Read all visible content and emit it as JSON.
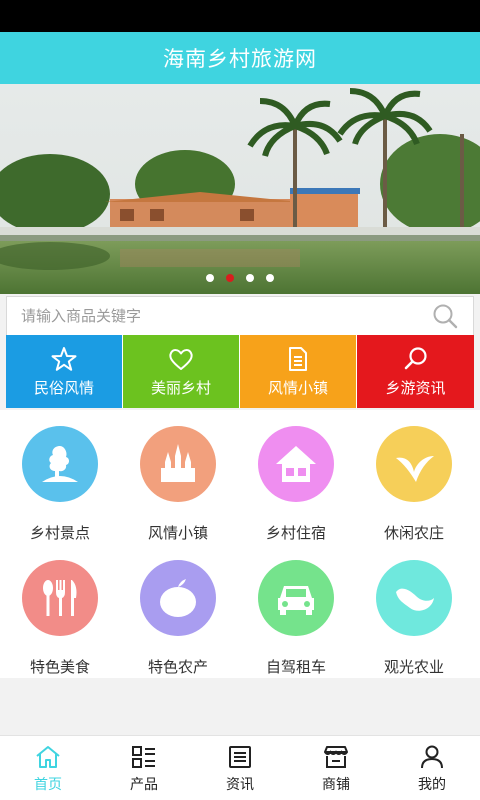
{
  "header": {
    "title": "海南乡村旅游网"
  },
  "banner": {
    "slide_count": 4,
    "active_index": 1
  },
  "search": {
    "placeholder": "请输入商品关键字"
  },
  "quick_links": [
    {
      "label": "民俗风情",
      "color": "#1b9ce3",
      "icon": "star-icon"
    },
    {
      "label": "美丽乡村",
      "color": "#6cc21f",
      "icon": "heart-icon"
    },
    {
      "label": "风情小镇",
      "color": "#f7a21a",
      "icon": "document-icon"
    },
    {
      "label": "乡游资讯",
      "color": "#e4181d",
      "icon": "search-icon"
    }
  ],
  "categories": [
    {
      "label": "乡村景点",
      "color": "#5ac1ec",
      "icon": "scenic-spot-icon"
    },
    {
      "label": "风情小镇",
      "color": "#f2a07d",
      "icon": "town-icon"
    },
    {
      "label": "乡村住宿",
      "color": "#ef8ef0",
      "icon": "house-icon"
    },
    {
      "label": "休闲农庄",
      "color": "#f6cf59",
      "icon": "leaf-icon"
    },
    {
      "label": "特色美食",
      "color": "#f28c88",
      "icon": "cutlery-icon"
    },
    {
      "label": "特色农产",
      "color": "#a99df0",
      "icon": "fruit-icon"
    },
    {
      "label": "自驾租车",
      "color": "#75e38c",
      "icon": "car-icon"
    },
    {
      "label": "观光农业",
      "color": "#6fe8dd",
      "icon": "bean-icon"
    }
  ],
  "tabs": [
    {
      "label": "首页",
      "icon": "home-icon",
      "active": true
    },
    {
      "label": "产品",
      "icon": "product-list-icon",
      "active": false
    },
    {
      "label": "资讯",
      "icon": "news-icon",
      "active": false
    },
    {
      "label": "商铺",
      "icon": "shop-icon",
      "active": false
    },
    {
      "label": "我的",
      "icon": "user-icon",
      "active": false
    }
  ],
  "colors": {
    "accent": "#3fd4e0",
    "active_dot": "#d81e1e"
  }
}
